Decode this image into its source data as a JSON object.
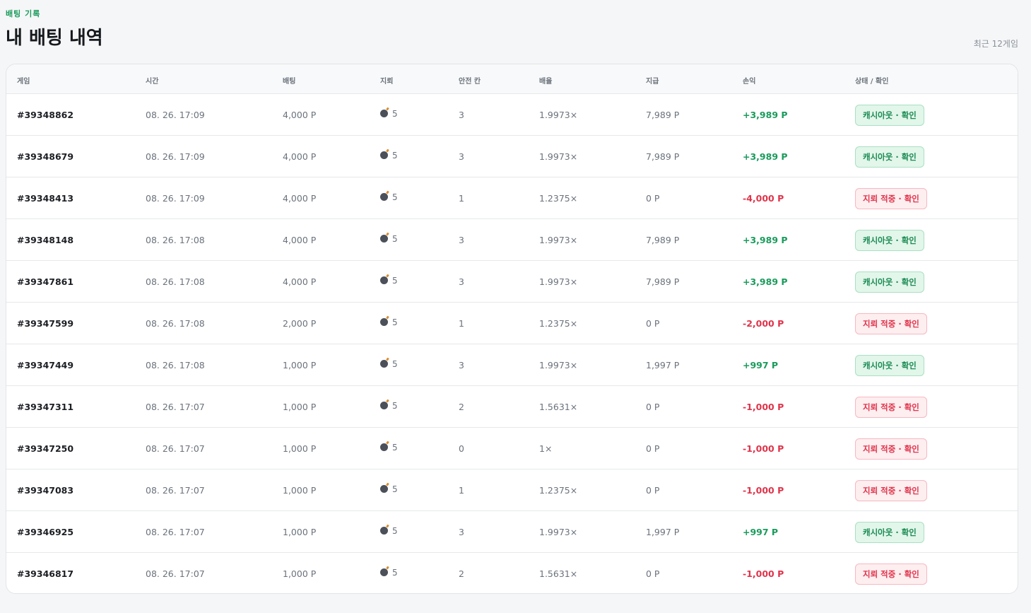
{
  "header": {
    "eyebrow": "배팅 기록",
    "title": "내 배팅 내역",
    "recent": "최근 12게임"
  },
  "columns": {
    "game": "게임",
    "time": "시간",
    "bet": "배팅",
    "mines": "지뢰",
    "safe": "안전 칸",
    "multiplier": "배율",
    "payout": "지급",
    "profit": "손익",
    "status": "상태 / 확인"
  },
  "colors": {
    "accent_green": "#1a9b5c",
    "loss_red": "#e0344b"
  },
  "rows": [
    {
      "game": "#39348862",
      "time": "08. 26. 17:09",
      "bet": "4,000 P",
      "mines": "5",
      "safe": "3",
      "mult": "1.9973×",
      "payout": "7,989 P",
      "profit": "+3,989 P",
      "status": "캐시아웃 · 확인",
      "result": "win",
      "icon": "bomb-icon"
    },
    {
      "game": "#39348679",
      "time": "08. 26. 17:09",
      "bet": "4,000 P",
      "mines": "5",
      "safe": "3",
      "mult": "1.9973×",
      "payout": "7,989 P",
      "profit": "+3,989 P",
      "status": "캐시아웃 · 확인",
      "result": "win",
      "icon": "bomb-icon"
    },
    {
      "game": "#39348413",
      "time": "08. 26. 17:09",
      "bet": "4,000 P",
      "mines": "5",
      "safe": "1",
      "mult": "1.2375×",
      "payout": "0 P",
      "profit": "-4,000 P",
      "status": "지뢰 적중 · 확인",
      "result": "lose",
      "icon": "bomb-icon"
    },
    {
      "game": "#39348148",
      "time": "08. 26. 17:08",
      "bet": "4,000 P",
      "mines": "5",
      "safe": "3",
      "mult": "1.9973×",
      "payout": "7,989 P",
      "profit": "+3,989 P",
      "status": "캐시아웃 · 확인",
      "result": "win",
      "icon": "bomb-icon"
    },
    {
      "game": "#39347861",
      "time": "08. 26. 17:08",
      "bet": "4,000 P",
      "mines": "5",
      "safe": "3",
      "mult": "1.9973×",
      "payout": "7,989 P",
      "profit": "+3,989 P",
      "status": "캐시아웃 · 확인",
      "result": "win",
      "icon": "bomb-icon"
    },
    {
      "game": "#39347599",
      "time": "08. 26. 17:08",
      "bet": "2,000 P",
      "mines": "5",
      "safe": "1",
      "mult": "1.2375×",
      "payout": "0 P",
      "profit": "-2,000 P",
      "status": "지뢰 적중 · 확인",
      "result": "lose",
      "icon": "bomb-icon"
    },
    {
      "game": "#39347449",
      "time": "08. 26. 17:08",
      "bet": "1,000 P",
      "mines": "5",
      "safe": "3",
      "mult": "1.9973×",
      "payout": "1,997 P",
      "profit": "+997 P",
      "status": "캐시아웃 · 확인",
      "result": "win",
      "icon": "bomb-icon"
    },
    {
      "game": "#39347311",
      "time": "08. 26. 17:07",
      "bet": "1,000 P",
      "mines": "5",
      "safe": "2",
      "mult": "1.5631×",
      "payout": "0 P",
      "profit": "-1,000 P",
      "status": "지뢰 적중 · 확인",
      "result": "lose",
      "icon": "bomb-icon"
    },
    {
      "game": "#39347250",
      "time": "08. 26. 17:07",
      "bet": "1,000 P",
      "mines": "5",
      "safe": "0",
      "mult": "1×",
      "payout": "0 P",
      "profit": "-1,000 P",
      "status": "지뢰 적중 · 확인",
      "result": "lose",
      "icon": "bomb-icon"
    },
    {
      "game": "#39347083",
      "time": "08. 26. 17:07",
      "bet": "1,000 P",
      "mines": "5",
      "safe": "1",
      "mult": "1.2375×",
      "payout": "0 P",
      "profit": "-1,000 P",
      "status": "지뢰 적중 · 확인",
      "result": "lose",
      "icon": "bomb-icon"
    },
    {
      "game": "#39346925",
      "time": "08. 26. 17:07",
      "bet": "1,000 P",
      "mines": "5",
      "safe": "3",
      "mult": "1.9973×",
      "payout": "1,997 P",
      "profit": "+997 P",
      "status": "캐시아웃 · 확인",
      "result": "win",
      "icon": "bomb-icon"
    },
    {
      "game": "#39346817",
      "time": "08. 26. 17:07",
      "bet": "1,000 P",
      "mines": "5",
      "safe": "2",
      "mult": "1.5631×",
      "payout": "0 P",
      "profit": "-1,000 P",
      "status": "지뢰 적중 · 확인",
      "result": "lose",
      "icon": "bomb-icon"
    }
  ]
}
